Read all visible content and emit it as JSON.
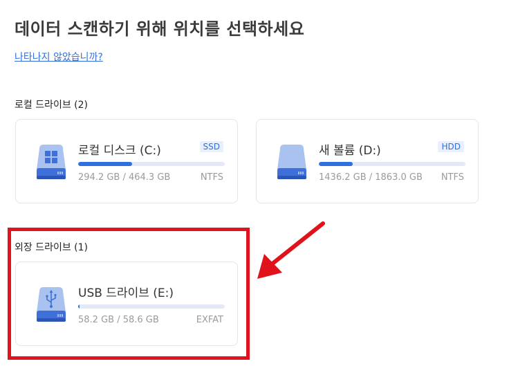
{
  "page": {
    "title": "데이터 스캔하기 위해 위치를 선택하세요",
    "help_link": "나타나지 않았습니까?"
  },
  "local_section": {
    "label": "로컬 드라이브 (2)",
    "drives": [
      {
        "name": "로컬 디스크 (C:)",
        "badge": "SSD",
        "usage": "294.2 GB / 464.3 GB",
        "filesystem": "NTFS",
        "used_fraction": 0.37,
        "icon": "windows-drive-icon"
      },
      {
        "name": "새 볼륨 (D:)",
        "badge": "HDD",
        "usage": "1436.2 GB / 1863.0 GB",
        "filesystem": "NTFS",
        "used_fraction": 0.23,
        "icon": "hard-drive-icon"
      }
    ]
  },
  "external_section": {
    "label": "외장 드라이브 (1)",
    "drives": [
      {
        "name": "USB 드라이브 (E:)",
        "usage": "58.2 GB / 58.6 GB",
        "filesystem": "EXFAT",
        "used_fraction": 0.01,
        "icon": "usb-drive-icon"
      }
    ]
  },
  "colors": {
    "accent": "#2f6fe0",
    "highlight": "#e0121b",
    "bar_track": "#e4eaf5"
  }
}
